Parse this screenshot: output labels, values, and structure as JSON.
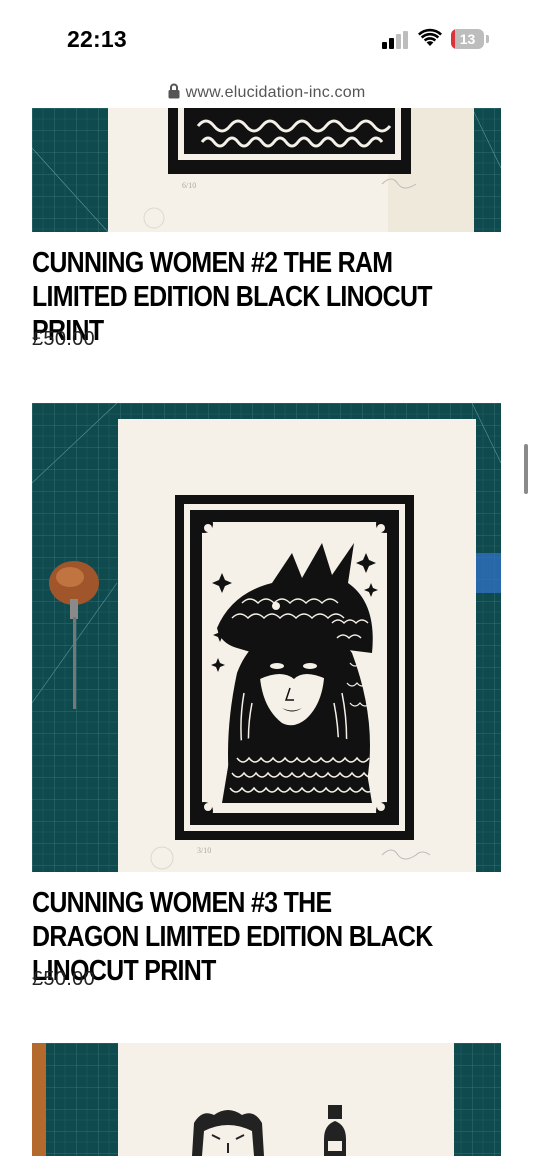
{
  "status_bar": {
    "time": "22:13",
    "battery_level": "13",
    "battery_color": "#e0303a",
    "icons": [
      "cellular-signal-icon",
      "wifi-icon",
      "battery-icon"
    ]
  },
  "browser": {
    "url": "www.elucidation-inc.com",
    "lock_icon": "lock-icon"
  },
  "products": [
    {
      "title": "CUNNING WOMEN #2 THE RAM LIMITED EDITION BLACK LINOCUT PRINT",
      "price": "£50.00"
    },
    {
      "title": "CUNNING WOMEN #3 THE DRAGON LIMITED EDITION BLACK LINOCUT PRINT",
      "price": "£50.00"
    }
  ],
  "colors": {
    "cutting_mat": "#0e4a4e",
    "paper": "#f5f1e8",
    "ink": "#111111"
  }
}
